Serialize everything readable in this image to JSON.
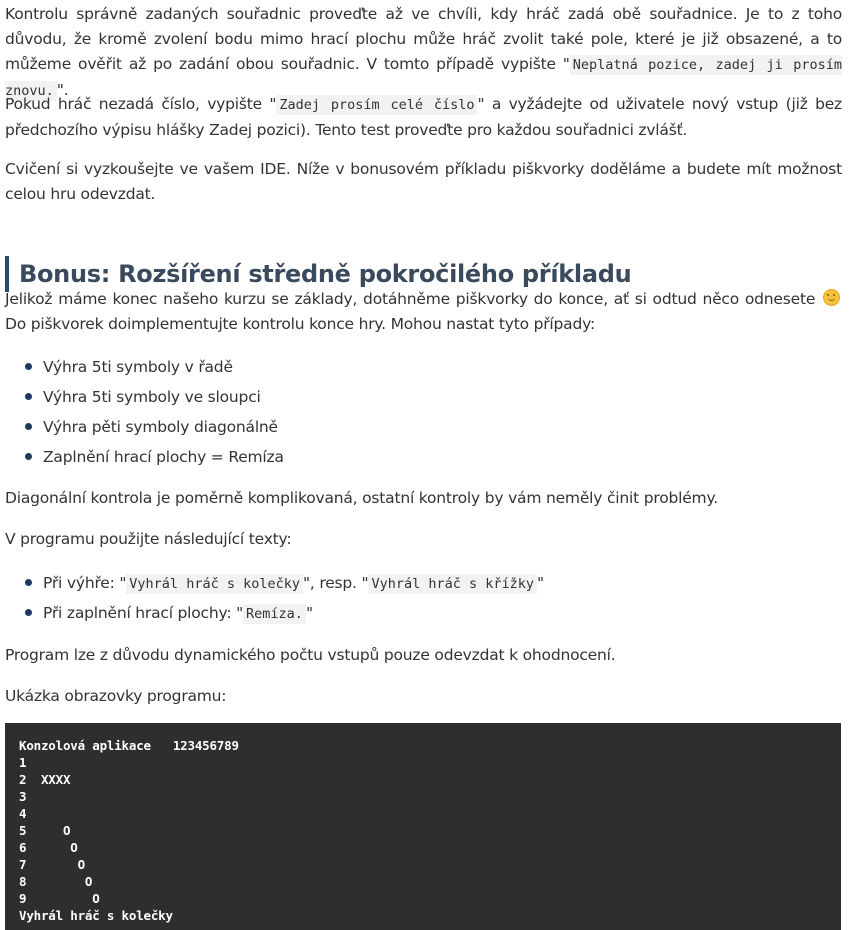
{
  "paragraph1": {
    "text_a": "Kontrolu správně zadaných souřadnic proveďte až ve chvíli, kdy hráč zadá obě souřadnice. Je to z toho důvodu, že kromě zvolení bodu mimo hrací plochu může hráč zvolit také pole, které je již obsazené, a to můžeme ověřit až po zadání obou souřadnic. V tomto případě vypište \"",
    "code": "Neplatná pozice, zadej ji prosím znovu.",
    "text_b": "\"."
  },
  "paragraph2": {
    "text_a": "Pokud hráč nezadá číslo, vypište \"",
    "code": "Zadej prosím celé číslo",
    "text_b": "\" a vyžádejte od uživatele nový vstup (již bez předchozího výpisu hlášky Zadej pozici). Tento test proveďte pro každou souřadnici zvlášť."
  },
  "paragraph3": "Cvičení si vyzkoušejte ve vašem IDE. Níže v bonusovém příkladu piškvorky doděláme a budete mít možnost celou hru odevzdat.",
  "heading": "Bonus: Rozšíření středně pokročilého příkladu",
  "paragraph4": {
    "text_a": "Jelikož máme konec našeho kurzu se základy, dotáhněme piškvorky do konce, ať si odtud něco odnesete",
    "text_b": " Do piškvorek doimplementujte kontrolu konce hry. Mohou nastat tyto případy:"
  },
  "cases": [
    "Výhra 5ti symboly v řadě",
    "Výhra 5ti symboly ve sloupci",
    "Výhra pěti symboly diagonálně",
    "Zaplnění hrací plochy = Remíza"
  ],
  "paragraph5": "Diagonální kontrola je poměrně komplikovaná, ostatní kontroly by vám neměly činit problémy.",
  "paragraph6": "V programu použijte následující texty:",
  "texts_list": [
    {
      "prefix": "Při výhře: \"",
      "code1": "Vyhrál hráč s kolečky",
      "mid": "\", resp. \"",
      "code2": "Vyhrál hráč s křížky",
      "suffix": "\""
    },
    {
      "prefix": "Při zaplnění hrací plochy: \"",
      "code1": "Remíza.",
      "suffix": "\""
    }
  ],
  "paragraph7": "Program lze z důvodu dynamického počtu vstupů pouze odevzdat k ohodnocení.",
  "paragraph8": "Ukázka obrazovky programu:",
  "console_lines": [
    "Konzolová aplikace   123456789",
    "1",
    "2  XXXX",
    "3",
    "4",
    "5     O",
    "6      O",
    "7       O",
    "8        O",
    "9         O",
    "Vyhrál hráč s kolečky"
  ],
  "colors": {
    "text": "#333333",
    "heading": "#3a4a5c",
    "heading_border": "#2c4a6b",
    "bullet": "#1e3a5f",
    "code_bg": "#f2f2f2",
    "console_bg": "#2e2e2e",
    "console_text": "#ffffff"
  },
  "icons": {
    "emoji": "smiley-icon",
    "bullet": "bullet-icon"
  }
}
